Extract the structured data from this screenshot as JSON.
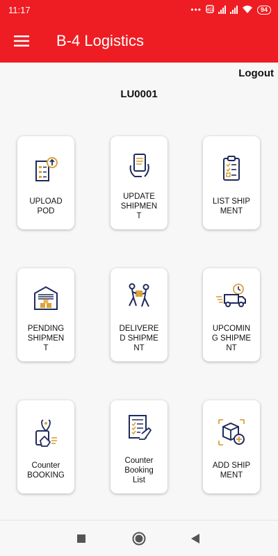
{
  "status_bar": {
    "time": "11:17",
    "dots": "•••",
    "battery": "94"
  },
  "app_bar": {
    "title": "B-4 Logistics"
  },
  "header": {
    "logout": "Logout",
    "user_code": "LU0001"
  },
  "tiles": [
    {
      "line1": "UPLOAD",
      "line2": "POD",
      "line3": "",
      "icon": "upload-document-icon"
    },
    {
      "line1": "UPDATE",
      "line2": "SHIPMEN",
      "line3": "T",
      "icon": "hand-tablet-icon"
    },
    {
      "line1": "LIST SHIP",
      "line2": "MENT",
      "line3": "",
      "icon": "clipboard-list-icon"
    },
    {
      "line1": "PENDING",
      "line2": "SHIPMEN",
      "line3": "T",
      "icon": "warehouse-icon"
    },
    {
      "line1": "DELIVERE",
      "line2": "D SHIPME",
      "line3": "NT",
      "icon": "delivery-people-icon"
    },
    {
      "line1": "UPCOMIN",
      "line2": "G SHIPME",
      "line3": "NT",
      "icon": "fast-truck-icon"
    },
    {
      "line1": "Counter",
      "line2": "BOOKING",
      "line3": "",
      "icon": "counter-booking-icon"
    },
    {
      "line1": "Counter",
      "line2": "Booking",
      "line3": "List",
      "icon": "booking-list-icon"
    },
    {
      "line1": "ADD SHIP",
      "line2": "MENT",
      "line3": "",
      "icon": "add-box-icon"
    }
  ],
  "colors": {
    "primary": "#ee1d23",
    "icon_navy": "#1f2a5c",
    "icon_gold": "#d9a23a"
  }
}
